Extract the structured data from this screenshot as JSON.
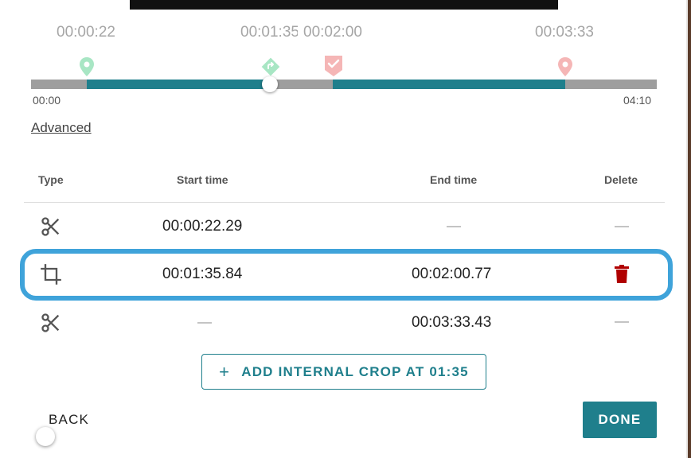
{
  "timeline": {
    "marker_times": [
      "00:00:22",
      "00:01:35",
      "00:02:00",
      "00:03:33"
    ],
    "start_label": "00:00",
    "end_label": "04:10",
    "colors": {
      "track": "#9e9e9e",
      "kept": "#1f7f8c",
      "start_pin": "#a8e6c4",
      "crop_pin": "#a8e6c4",
      "end_pin": "#f5b6b6"
    }
  },
  "advanced": {
    "label": "Advanced"
  },
  "table": {
    "headers": {
      "type": "Type",
      "start": "Start time",
      "end": "End time",
      "delete": "Delete"
    },
    "rows": [
      {
        "type_icon": "scissors-icon",
        "start": "00:00:22.29",
        "end": "",
        "deletable": false
      },
      {
        "type_icon": "crop-icon",
        "start": "00:01:35.84",
        "end": "00:02:00.77",
        "deletable": true
      },
      {
        "type_icon": "scissors-icon",
        "start": "",
        "end": "00:03:33.43",
        "deletable": false
      }
    ],
    "highlight_color": "#3fa3da",
    "delete_color": "#b00000"
  },
  "actions": {
    "add_crop_label": "ADD INTERNAL CROP AT 01:35",
    "back_label": "BACK",
    "done_label": "DONE"
  }
}
